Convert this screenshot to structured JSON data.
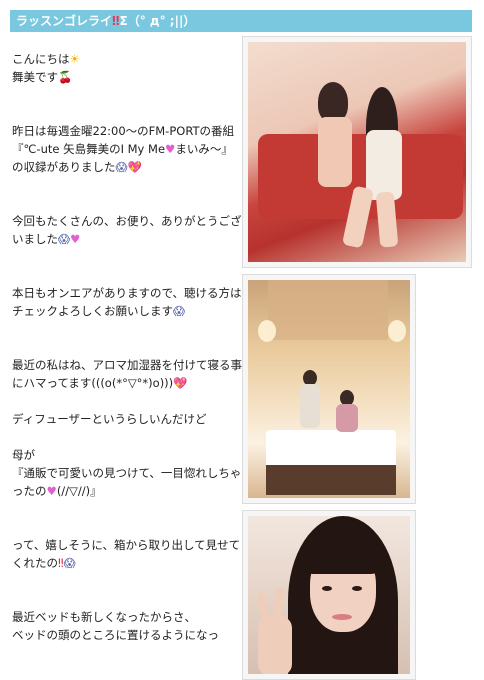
{
  "entry": {
    "title_text": "ラッスンゴレライ",
    "title_marks": "‼",
    "title_suffix": "Σ（° д° ;||）"
  },
  "body": {
    "greeting": "こんにちは",
    "name_line": "舞美です",
    "para1": "昨日は毎週金曜22:00～のFM-PORTの番組『℃-ute 矢島舞美のI My Me",
    "para1_b": "まいみ～』の収録がありました",
    "para2": "今回もたくさんの、お便り、ありがとうございました",
    "para3": "本日もオンエアがありますので、聴ける方はチェックよろしくお願いします",
    "para4": "最近の私はね、アロマ加湿器を付けて寝る事にハマってます(((o(*°▽°*)o)))",
    "para5": "ディフューザーというらしいんだけど",
    "para6a": "母が",
    "para6b": "『通販で可愛いの見つけて、一目惚れしちゃったの",
    "para6c": "(//▽//)』",
    "para7": "って、嬉しそうに、箱から取り出して見せてくれたの",
    "para8a": "最近ベッドも新しくなったからさ、",
    "para8b": "ベッドの頭のところに置けるようになっ"
  },
  "icons": {
    "sun": "sun-emoji",
    "cherry": "cherry-emoji",
    "heart": "heart-emoji",
    "scared_face": "scared-face-emoji",
    "sparkle_heart": "sparkle-heart-emoji",
    "exclamation": "double-exclamation-emoji"
  },
  "colors": {
    "title_bar": "#7ac8e0",
    "heart": "#e060d0",
    "exclamation": "#e02040"
  }
}
